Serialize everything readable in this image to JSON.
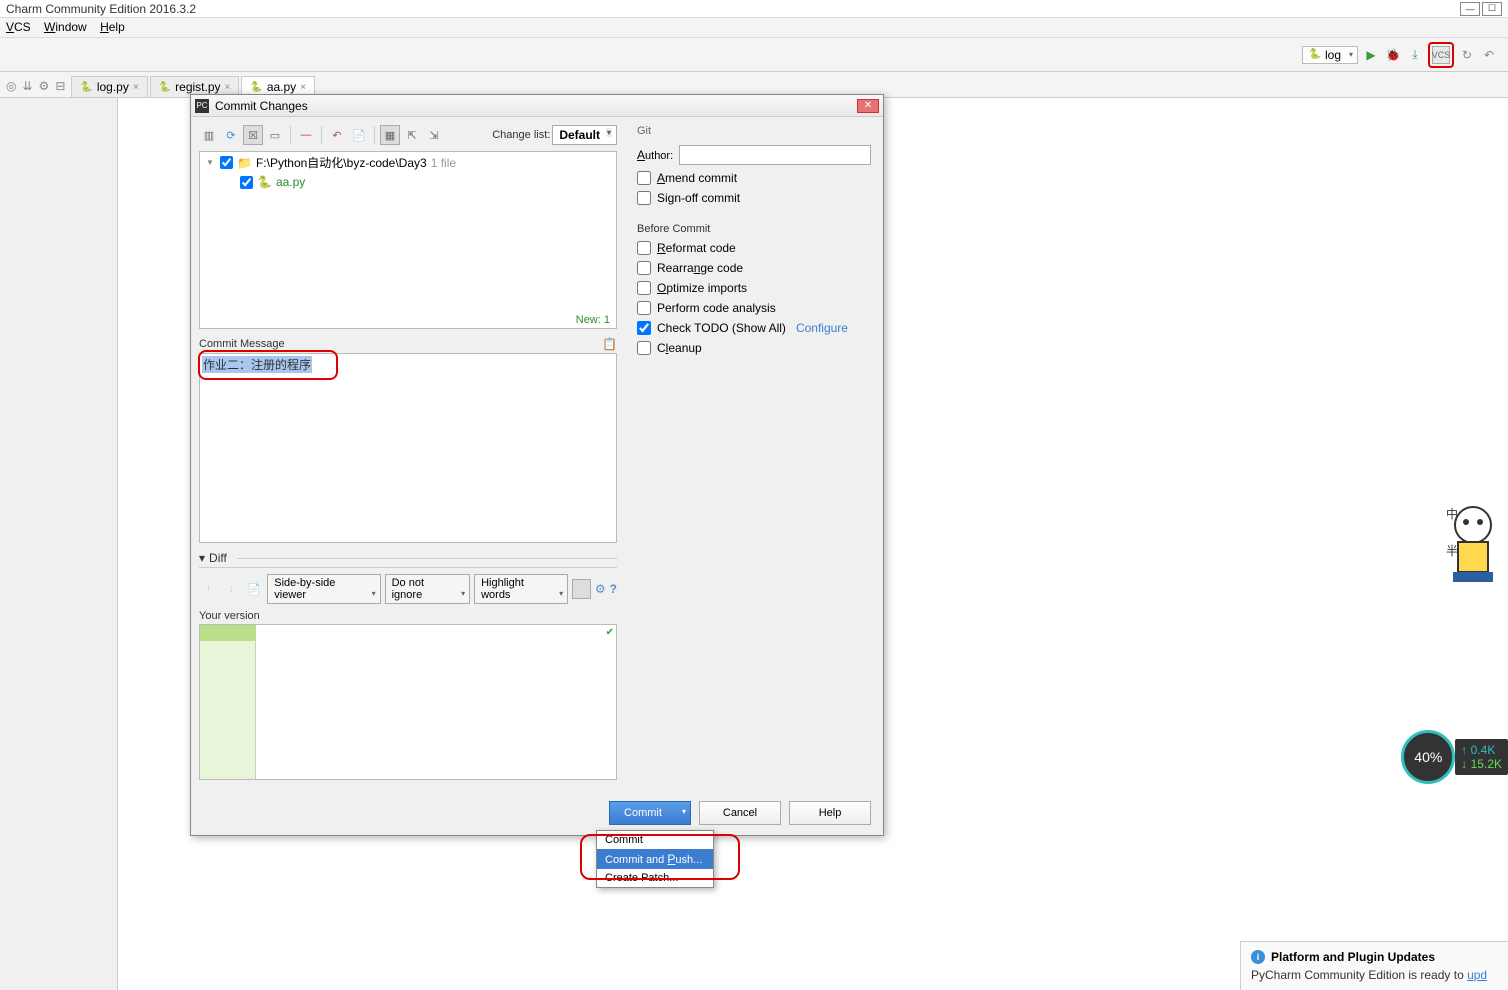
{
  "window": {
    "title": "Charm Community Edition 2016.3.2"
  },
  "menu": {
    "vcs": "VCS",
    "window": "Window",
    "help": "Help"
  },
  "toolbar": {
    "run_config": "log",
    "vcs_label": "VCS"
  },
  "tabs": {
    "items": [
      {
        "label": "log.py"
      },
      {
        "label": "regist.py"
      },
      {
        "label": "aa.py"
      }
    ]
  },
  "dialog": {
    "title": "Commit Changes",
    "changelist_label": "Change list:",
    "changelist_value": "Default",
    "tree": {
      "root": "F:\\Python自动化\\byz-code\\Day3",
      "root_hint": "1 file",
      "file": "aa.py",
      "status": "New: 1"
    },
    "commit_msg_label": "Commit Message",
    "commit_msg_text": "作业二：注册的程序",
    "diff": {
      "label": "Diff",
      "viewer": "Side-by-side viewer",
      "ignore": "Do not ignore",
      "highlight": "Highlight words",
      "your_version": "Your version"
    },
    "buttons": {
      "commit": "Commit",
      "cancel": "Cancel",
      "help": "Help"
    },
    "commit_menu": {
      "commit": "Commit",
      "commit_push": "Commit and Push...",
      "create_patch": "Create Patch..."
    },
    "right": {
      "git": "Git",
      "author": "Author:",
      "amend": "Amend commit",
      "signoff": "Sign-off commit",
      "before_commit": "Before Commit",
      "reformat": "Reformat code",
      "rearrange": "Rearrange code",
      "optimize": "Optimize imports",
      "analysis": "Perform code analysis",
      "todo": "Check TODO (Show All)",
      "configure": "Configure",
      "cleanup": "Cleanup"
    }
  },
  "notification": {
    "title": "Platform and Plugin Updates",
    "body": "PyCharm Community Edition is ready to ",
    "link": "upd"
  },
  "speed": {
    "pct": "40%",
    "up": "↑ 0.4K",
    "down": "↓ 15.2K"
  }
}
